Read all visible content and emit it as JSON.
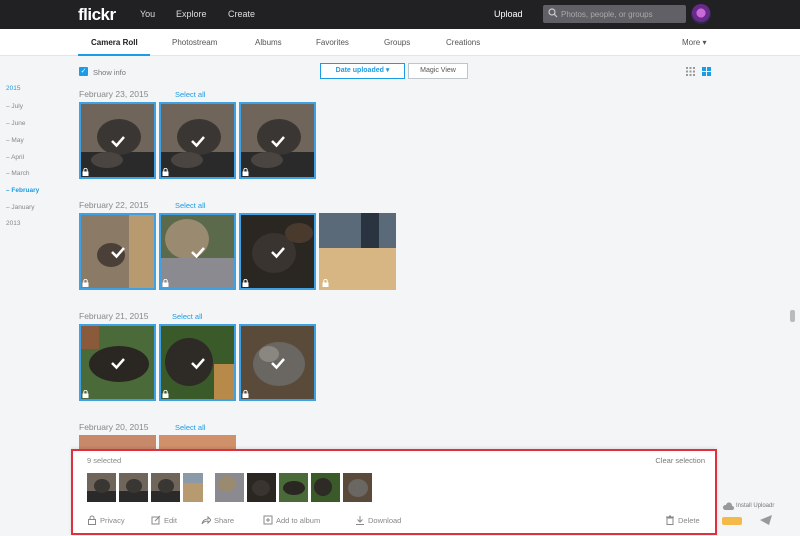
{
  "topbar": {
    "logo": "flickr",
    "nav": [
      "You",
      "Explore",
      "Create"
    ],
    "upload": "Upload",
    "search_placeholder": "Photos, people, or groups"
  },
  "subnav": {
    "tabs": [
      "Camera Roll",
      "Photostream",
      "Albums",
      "Favorites",
      "Groups",
      "Creations"
    ],
    "more": "More ▾"
  },
  "toolbar": {
    "show_info": "Show info",
    "sort_button": "Date uploaded ▾",
    "magic_view": "Magic View"
  },
  "timeline": [
    "2015",
    "July",
    "June",
    "May",
    "April",
    "March",
    "February",
    "January",
    "2013"
  ],
  "sections": [
    {
      "date": "February 23, 2015",
      "select_all": "Select all"
    },
    {
      "date": "February 22, 2015",
      "select_all": "Select all"
    },
    {
      "date": "February 21, 2015",
      "select_all": "Select all"
    },
    {
      "date": "February 20, 2015",
      "select_all": "Select all"
    }
  ],
  "selection_panel": {
    "count": "9 selected",
    "clear": "Clear selection",
    "actions": [
      "Privacy",
      "Edit",
      "Share",
      "Add to album",
      "Download"
    ],
    "delete": "Delete"
  },
  "sidebar_extra": {
    "install_uploadr": "Install Uploadr"
  },
  "colors": {
    "accent": "#1c9be6",
    "topbar": "#212124",
    "highlight_border": "#e03040"
  }
}
